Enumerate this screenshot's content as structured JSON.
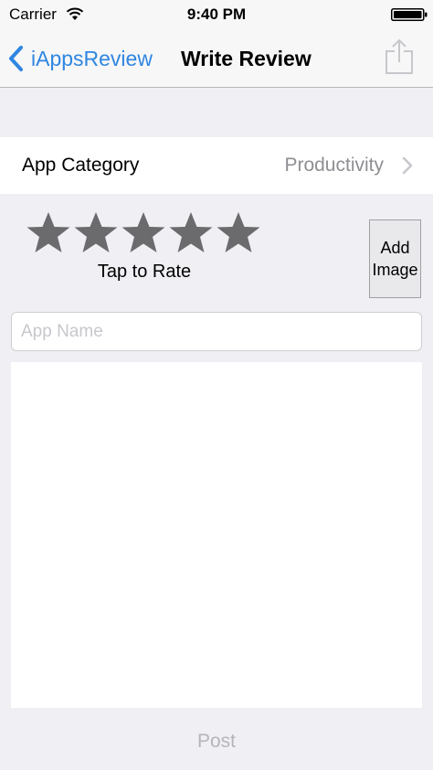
{
  "status_bar": {
    "carrier": "Carrier",
    "time": "9:40 PM",
    "wifi_icon": "wifi-icon",
    "battery_icon": "battery-icon"
  },
  "nav": {
    "back_label": "iAppsReview",
    "title": "Write Review",
    "share_icon": "share-icon",
    "accent_color": "#2f86e0"
  },
  "category": {
    "label": "App Category",
    "value": "Productivity"
  },
  "rating": {
    "stars_total": 5,
    "stars_selected": 0,
    "caption": "Tap to Rate",
    "star_color": "#6b6b6e"
  },
  "add_image": {
    "label": "Add\nImage"
  },
  "app_name": {
    "placeholder": "App Name",
    "value": ""
  },
  "review": {
    "value": ""
  },
  "post": {
    "label": "Post"
  }
}
